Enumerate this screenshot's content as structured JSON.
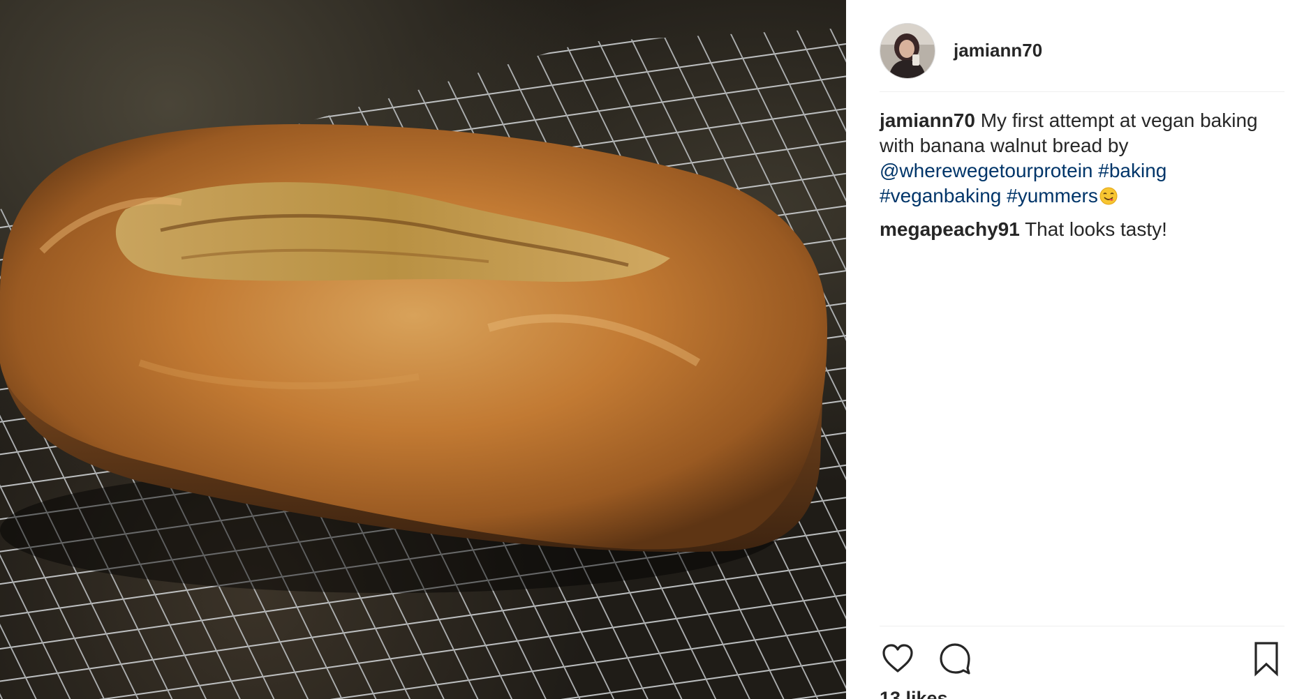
{
  "post": {
    "username": "jamiann70",
    "caption": {
      "username": "jamiann70",
      "text": " My first attempt at vegan baking with banana walnut bread by ",
      "mention": "@wherewegetourprotein",
      "hashtags": [
        "#baking",
        "#veganbaking",
        "#yummers"
      ],
      "emoji": "smiling-face-savoring-food"
    },
    "comments": [
      {
        "username": "megapeachy91",
        "text": " That looks tasty!"
      }
    ],
    "likes": "13 likes"
  },
  "icons": {
    "like": "heart-outline-icon",
    "comment": "speech-bubble-icon",
    "save": "bookmark-outline-icon"
  },
  "colors": {
    "link": "#003569",
    "text": "#262626",
    "divider": "#efefef"
  }
}
